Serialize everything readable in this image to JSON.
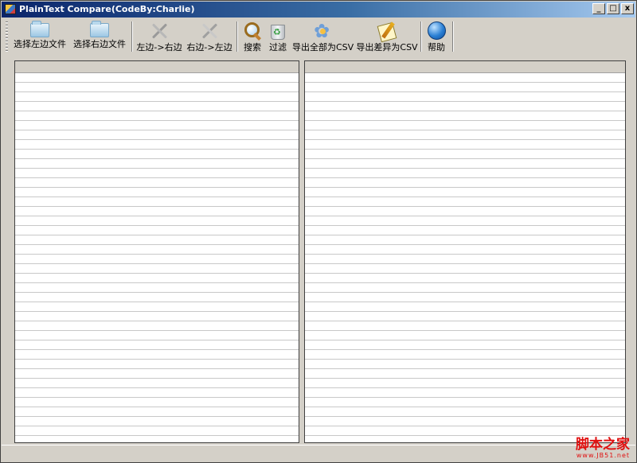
{
  "window": {
    "title": "PlainText Compare(CodeBy:Charlie)",
    "controls": {
      "minimize": "_",
      "maximize": "□",
      "close": "x"
    }
  },
  "toolbar": {
    "items": [
      {
        "label": "选择左边文件",
        "icon": "folder-icon"
      },
      {
        "label": "选择右边文件",
        "icon": "folder-icon"
      },
      {
        "label": "左边->右边",
        "icon": "tools-icon"
      },
      {
        "label": "右边->左边",
        "icon": "tools-icon"
      },
      {
        "label": "搜索",
        "icon": "search-icon"
      },
      {
        "label": "过滤",
        "icon": "recycle-bin-icon"
      },
      {
        "label": "导出全部为CSV",
        "icon": "flower-icon"
      },
      {
        "label": "导出差异为CSV",
        "icon": "pencil-icon"
      },
      {
        "label": "帮助",
        "icon": "help-globe-icon"
      }
    ]
  },
  "watermark": {
    "main": "脚本之家",
    "sub": "www.JB51.net"
  },
  "colors": {
    "titlebar_start": "#0a246a",
    "titlebar_end": "#a6caf0",
    "window_bg": "#d4d0c8",
    "watermark": "#e01010"
  }
}
